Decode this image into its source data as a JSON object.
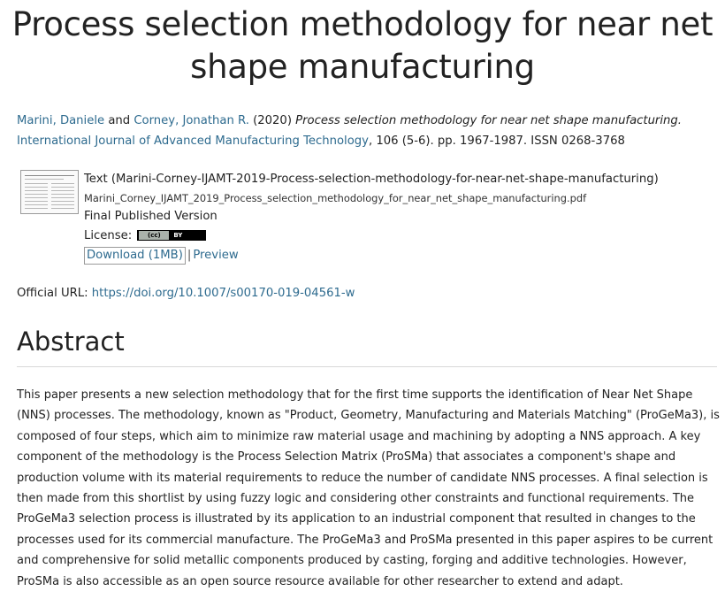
{
  "title": {
    "line1": "Process selection methodology for near net",
    "line2": "shape manufacturing"
  },
  "citation": {
    "author1": "Marini, Daniele",
    "and": "and",
    "author2": "Corney, Jonathan R.",
    "year": "(2020)",
    "title": "Process selection methodology for near net shape manufacturing.",
    "journal": "International Journal of Advanced Manufacturing Technology",
    "details": ", 106 (5-6). pp. 1967-1987. ISSN 0268-3768"
  },
  "document": {
    "type_line": "Text (Marini-Corney-IJAMT-2019-Process-selection-methodology-for-near-net-shape-manufacturing)",
    "filename": "Marini_Corney_IJAMT_2019_Process_selection_methodology_for_near_net_shape_manufacturing.pdf",
    "version": "Final Published Version",
    "license_label": "License:",
    "license_badge_cc": "(cc)",
    "license_badge_by": "BY",
    "download_label": "Download (1MB)",
    "separator": "|",
    "preview_label": "Preview"
  },
  "official_url": {
    "label": "Official URL:",
    "url": "https://doi.org/10.1007/s00170-019-04561-w"
  },
  "abstract": {
    "heading": "Abstract",
    "body": "This paper presents a new selection methodology that for the first time supports the identification of Near Net Shape (NNS) processes. The methodology, known as \"Product, Geometry, Manufacturing and Materials Matching\" (ProGeMa3), is composed of four steps, which aim to minimize raw material usage and machining by adopting a NNS approach. A key component of the methodology is the Process Selection Matrix (ProSMa) that associates a component's shape and production volume with its material requirements to reduce the number of candidate NNS processes. A final selection is then made from this shortlist by using fuzzy logic and considering other constraints and functional requirements. The ProGeMa3 selection process is illustrated by its application to an industrial component that resulted in changes to the processes used for its commercial manufacture. The ProGeMa3 and ProSMa presented in this paper aspires to be current and comprehensive for solid metallic components produced by casting, forging and additive technologies. However, ProSMa is also accessible as an open source resource available for other researcher to extend and adapt."
  },
  "colors": {
    "link": "#2e6b8f",
    "text": "#222222",
    "rule": "#d9d9d9"
  }
}
